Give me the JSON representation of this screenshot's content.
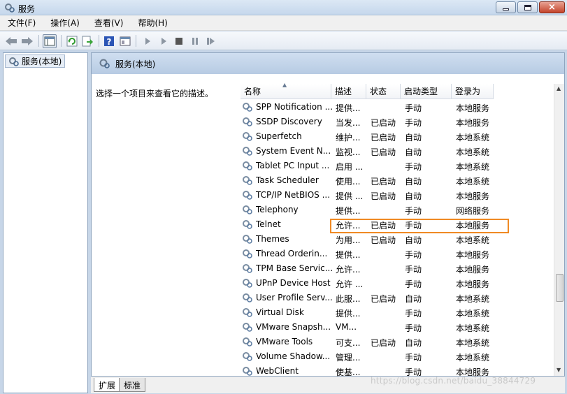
{
  "window": {
    "title": "服务",
    "controls": {
      "minimize": "minimize-icon",
      "maximize": "maximize-icon",
      "close": "×"
    }
  },
  "menu": [
    "文件(F)",
    "操作(A)",
    "查看(V)",
    "帮助(H)"
  ],
  "toolbar": {
    "icons": [
      "back-icon",
      "forward-icon",
      "show-tree-icon",
      "refresh-icon",
      "export-icon",
      "help-icon",
      "properties-icon",
      "play-icon",
      "play-alt-icon",
      "stop-icon",
      "pause-icon",
      "restart-icon"
    ]
  },
  "tree": {
    "item_label": "服务(本地)"
  },
  "panel": {
    "header_title": "服务(本地)",
    "description_hint": "选择一个项目来查看它的描述。"
  },
  "columns": [
    "名称",
    "描述",
    "状态",
    "启动类型",
    "登录为"
  ],
  "services": [
    {
      "name": "SPP Notification ...",
      "desc": "提供...",
      "status": "",
      "start": "手动",
      "logon": "本地服务"
    },
    {
      "name": "SSDP Discovery",
      "desc": "当发...",
      "status": "已启动",
      "start": "手动",
      "logon": "本地服务"
    },
    {
      "name": "Superfetch",
      "desc": "维护...",
      "status": "已启动",
      "start": "自动",
      "logon": "本地系统"
    },
    {
      "name": "System Event N...",
      "desc": "监视...",
      "status": "已启动",
      "start": "自动",
      "logon": "本地系统"
    },
    {
      "name": "Tablet PC Input ...",
      "desc": "启用 ...",
      "status": "",
      "start": "手动",
      "logon": "本地系统"
    },
    {
      "name": "Task Scheduler",
      "desc": "使用...",
      "status": "已启动",
      "start": "自动",
      "logon": "本地系统"
    },
    {
      "name": "TCP/IP NetBIOS ...",
      "desc": "提供 ...",
      "status": "已启动",
      "start": "自动",
      "logon": "本地服务"
    },
    {
      "name": "Telephony",
      "desc": "提供...",
      "status": "",
      "start": "手动",
      "logon": "网络服务"
    },
    {
      "name": "Telnet",
      "desc": "允许...",
      "status": "已启动",
      "start": "手动",
      "logon": "本地服务"
    },
    {
      "name": "Themes",
      "desc": "为用...",
      "status": "已启动",
      "start": "自动",
      "logon": "本地系统"
    },
    {
      "name": "Thread Orderin...",
      "desc": "提供...",
      "status": "",
      "start": "手动",
      "logon": "本地服务"
    },
    {
      "name": "TPM Base Servic...",
      "desc": "允许...",
      "status": "",
      "start": "手动",
      "logon": "本地服务"
    },
    {
      "name": "UPnP Device Host",
      "desc": "允许 ...",
      "status": "",
      "start": "手动",
      "logon": "本地服务"
    },
    {
      "name": "User Profile Serv...",
      "desc": "此服...",
      "status": "已启动",
      "start": "自动",
      "logon": "本地系统"
    },
    {
      "name": "Virtual Disk",
      "desc": "提供...",
      "status": "",
      "start": "手动",
      "logon": "本地系统"
    },
    {
      "name": "VMware Snapsh...",
      "desc": "VM...",
      "status": "",
      "start": "手动",
      "logon": "本地系统"
    },
    {
      "name": "VMware Tools",
      "desc": "可支...",
      "status": "已启动",
      "start": "自动",
      "logon": "本地系统"
    },
    {
      "name": "Volume Shadow...",
      "desc": "管理...",
      "status": "",
      "start": "手动",
      "logon": "本地系统"
    },
    {
      "name": "WebClient",
      "desc": "使基...",
      "status": "",
      "start": "手动",
      "logon": "本地服务"
    }
  ],
  "highlight_color": "#f08a24",
  "tabs": [
    "扩展",
    "标准"
  ],
  "watermark": "https://blog.csdn.net/baidu_38844729"
}
